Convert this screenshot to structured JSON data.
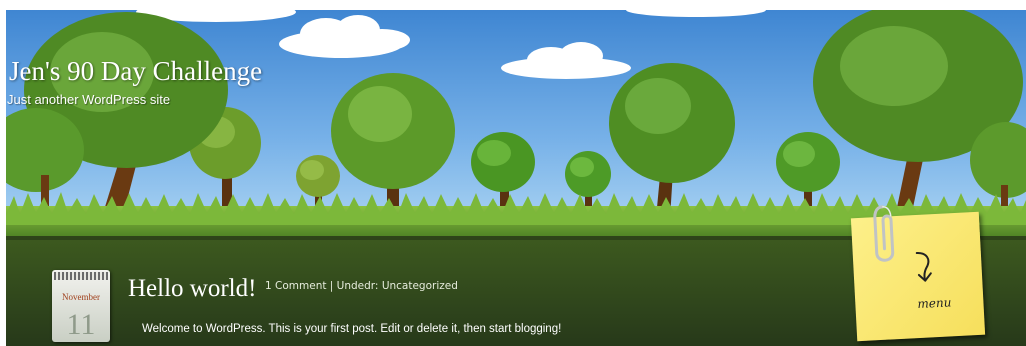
{
  "site": {
    "title": "Jen's 90 Day Challenge",
    "tagline": "Just another WordPress site"
  },
  "post": {
    "date_month": "November",
    "date_day": "11",
    "title": "Hello world!",
    "meta": "1 Comment | Undedr: Uncategorized",
    "excerpt": "Welcome to WordPress. This is your first post. Edit or delete it, then start blogging!"
  },
  "menu": {
    "label": "menu",
    "icon": "paperclip-icon"
  },
  "colors": {
    "sky": "#4f93d8",
    "grass": "#5d9a2e",
    "content_bg": "#2f4418",
    "note": "#f9e670"
  }
}
